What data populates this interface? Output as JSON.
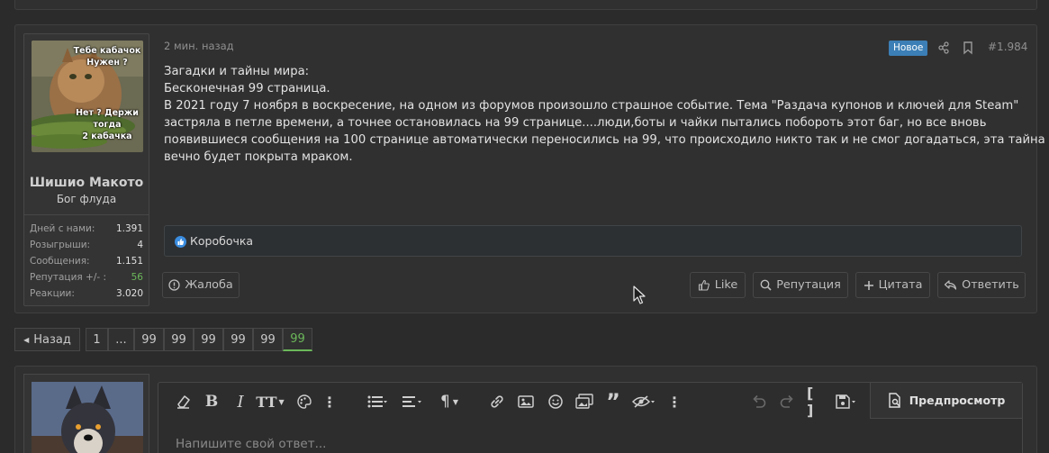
{
  "post": {
    "time": "2 мин. назад",
    "badge_new": "Новое",
    "number": "#1.984",
    "avatar_text": {
      "top": "Тебе кабачок\nНужен ?",
      "bottom": "Нет ? Держи\nтогда\n2 кабачка"
    },
    "user": {
      "name": "Шишио Макото",
      "title": "Бог флуда",
      "stats": [
        {
          "label": "Дней с нами:",
          "value": "1.391"
        },
        {
          "label": "Розыгрыши:",
          "value": "4"
        },
        {
          "label": "Сообщения:",
          "value": "1.151"
        },
        {
          "label": "Репутация +/- :",
          "value": "56"
        },
        {
          "label": "Реакции:",
          "value": "3.020"
        }
      ]
    },
    "body_lines": [
      "Загадки и тайны мира:",
      "Бесконечная 99 страница.",
      "В 2021 году 7 ноября в воскресение, на одном из форумов произошло страшное событие. Тема \"Раздача купонов и ключей для Steam\"",
      "застряла в петле времени, а точнее остановилась на 99 странице....люди,боты и чайки пытались побороть этот баг, но все вновь",
      "появившиеся сообщения на 100 странице автоматически переносились на 99, что происходило никто так и не смог догадаться, эта тайна",
      "вечно будет покрыта мраком."
    ],
    "reactions": "Коробочка",
    "actions": {
      "report": "Жалоба",
      "like": "Like",
      "reputation": "Репутация",
      "quote": "Цитата",
      "reply": "Ответить"
    }
  },
  "pagination": {
    "prev": "Назад",
    "pages": [
      "1",
      "...",
      "99",
      "99",
      "99",
      "99",
      "99",
      "99"
    ],
    "active_index": 7
  },
  "editor": {
    "placeholder": "Напишите свой ответ...",
    "preview_label": "Предпросмотр"
  },
  "colors": {
    "background": "#2b2b2b",
    "panel": "#303030",
    "badge": "#3c7fb6",
    "accent_green": "#6bb85a",
    "like_blue": "#3a8de0"
  }
}
